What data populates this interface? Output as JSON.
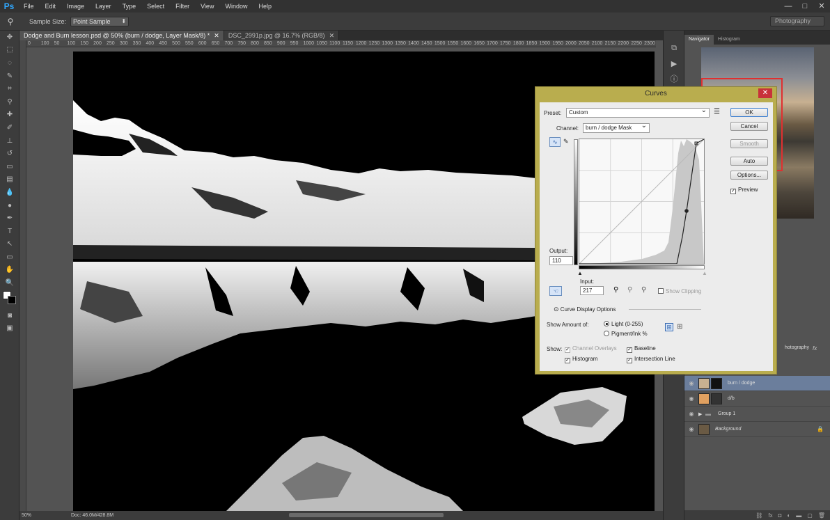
{
  "app": {
    "logo": "Ps",
    "menu": [
      "File",
      "Edit",
      "Image",
      "Layer",
      "Type",
      "Select",
      "Filter",
      "View",
      "Window",
      "Help"
    ],
    "window_controls": [
      "—",
      "□",
      "✕"
    ]
  },
  "options_bar": {
    "sample_size_label": "Sample Size:",
    "sample_size_value": "Point Sample",
    "workspace": "Photography"
  },
  "tabs": [
    {
      "label": "Dodge and Burn lesson.psd @ 50% (burn / dodge, Layer Mask/8) *",
      "close": "✕"
    },
    {
      "label": "DSC_2991p.jpg @ 16.7% (RGB/8)",
      "close": "✕"
    }
  ],
  "ruler_top": [
    "0",
    "100",
    "50",
    "100",
    "150",
    "200",
    "250",
    "300",
    "350",
    "400",
    "450",
    "500",
    "550",
    "600",
    "650",
    "700",
    "750",
    "800",
    "850",
    "900",
    "950",
    "1000",
    "1050",
    "1100",
    "1150",
    "1200",
    "1250",
    "1300",
    "1350",
    "1400",
    "1450",
    "1500",
    "1550",
    "1600",
    "1650",
    "1700",
    "1750",
    "1800",
    "1850",
    "1900",
    "1950",
    "2000",
    "2050",
    "2100",
    "2150",
    "2200",
    "2250",
    "2300"
  ],
  "status": {
    "zoom": "50%",
    "doc": "Doc: 46.0M/428.8M"
  },
  "panels": {
    "navigator_tab": "Navigator",
    "histogram_tab": "Histogram",
    "adjustment_label": "hotography",
    "fx": "fx",
    "layers": [
      {
        "name": "burn / dodge",
        "selected": true
      },
      {
        "name": "d/b",
        "selected": false
      },
      {
        "name": "Group 1",
        "selected": false
      },
      {
        "name": "Background",
        "selected": false
      }
    ],
    "lock": "🔒"
  },
  "curves": {
    "title": "Curves",
    "close": "✕",
    "preset_label": "Preset:",
    "preset_value": "Custom",
    "channel_label": "Channel:",
    "channel_value": "burn / dodge Mask",
    "output_label": "Output:",
    "output_value": "110",
    "input_label": "Input:",
    "input_value": "217",
    "show_clipping": "Show Clipping",
    "display_options": "Curve Display Options",
    "show_amount_label": "Show Amount of:",
    "light_option": "Light  (0-255)",
    "pigment_option": "Pigment/Ink %",
    "show_label": "Show:",
    "channel_overlays": "Channel Overlays",
    "baseline": "Baseline",
    "histogram": "Histogram",
    "intersection_line": "Intersection Line",
    "buttons": {
      "ok": "OK",
      "cancel": "Cancel",
      "smooth": "Smooth",
      "auto": "Auto",
      "options": "Options...",
      "preview": "Preview"
    }
  }
}
